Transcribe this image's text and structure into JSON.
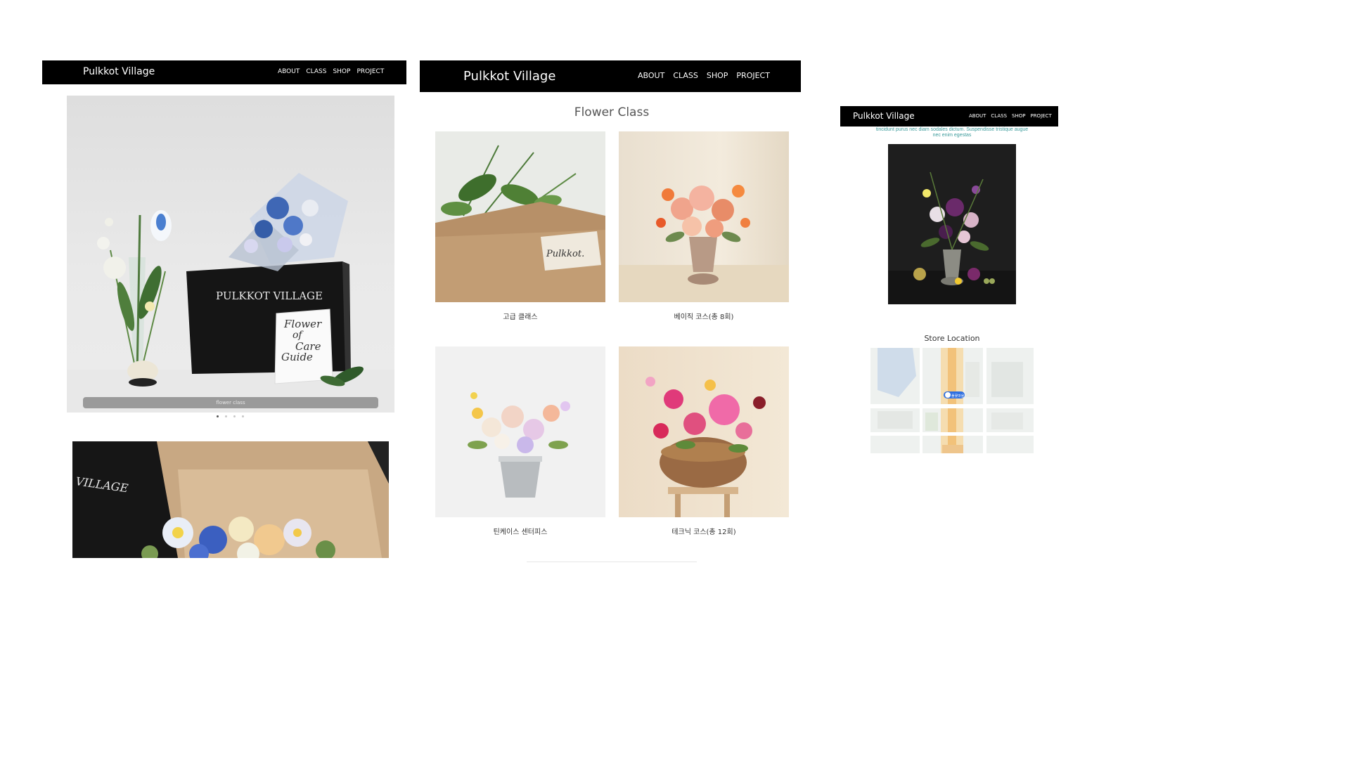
{
  "panel_left": {
    "brand": "Pulkkot Village",
    "nav": [
      "ABOUT",
      "CLASS",
      "SHOP",
      "PROJECT"
    ],
    "hero": {
      "box_text": "PULKKOT VILLAGE",
      "card_lines": [
        "Flower",
        "of",
        "Care",
        "Guide"
      ],
      "overlay_label": "flower class",
      "slide_count": 4,
      "active_slide": 1
    },
    "second_image": {
      "box_text": "VILLAGE"
    }
  },
  "panel_center": {
    "brand": "Pulkkot Village",
    "nav": [
      "ABOUT",
      "CLASS",
      "SHOP",
      "PROJECT"
    ],
    "title": "Flower Class",
    "classes": [
      {
        "name": "고급 클래스",
        "wrap_label": "Pulkkot."
      },
      {
        "name": "베이직 코스(총 8회)"
      },
      {
        "name": "틴케이스 센터피스"
      },
      {
        "name": "테크닉 코스(총 12회)"
      }
    ]
  },
  "panel_right": {
    "brand": "Pulkkot Village",
    "nav": [
      "ABOUT",
      "CLASS",
      "SHOP",
      "PROJECT"
    ],
    "intro_lines": [
      "tincidunt purus nec diam sodales dictum. Suspendisse tristique augue",
      "nec enim egestas"
    ],
    "location_title": "Store Location",
    "map_pin_label": "풀꽃마을"
  },
  "colors": {
    "nav_bg": "#000000",
    "nav_text": "#ffffff",
    "intro_text": "#3a9a9a",
    "map_pin": "#2f6fe0",
    "map_road": "#f2c27a"
  }
}
